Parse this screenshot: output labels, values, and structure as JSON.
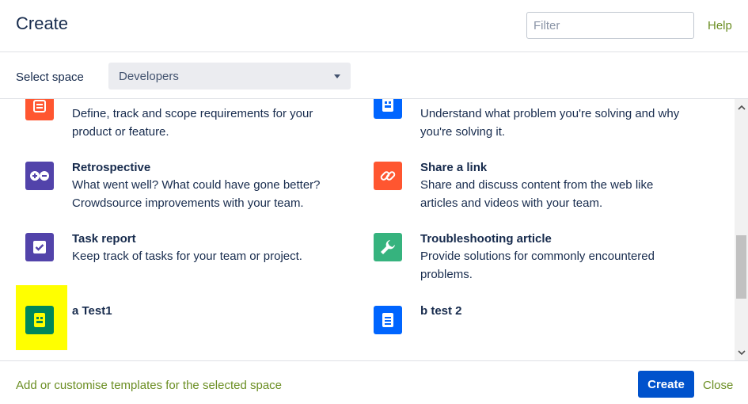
{
  "dialog": {
    "title": "Create",
    "filter_placeholder": "Filter",
    "help_label": "Help"
  },
  "space": {
    "label": "Select space",
    "selected": "Developers"
  },
  "templates": [
    {
      "name": "",
      "description": "Define, track and scope requirements for your product or feature.",
      "icon": "requirements-icon",
      "color": "#ff5630"
    },
    {
      "name": "",
      "description": "Understand what problem you're solving and why you're solving it.",
      "icon": "document-icon",
      "color": "#0065ff"
    },
    {
      "name": "Retrospective",
      "description": "What went well? What could have gone better? Crowdsource improvements with your team.",
      "icon": "retrospective-icon",
      "color": "#5243aa"
    },
    {
      "name": "Share a link",
      "description": "Share and discuss content from the web like articles and videos with your team.",
      "icon": "link-icon",
      "color": "#ff5630"
    },
    {
      "name": "Task report",
      "description": "Keep track of tasks for your team or project.",
      "icon": "checkbox-icon",
      "color": "#5243aa"
    },
    {
      "name": "Troubleshooting article",
      "description": "Provide solutions for commonly encountered problems.",
      "icon": "wrench-icon",
      "color": "#36b37e"
    },
    {
      "name": "a Test1",
      "description": "",
      "icon": "template-icon",
      "color": "#00875a",
      "highlight": "#ffff00"
    },
    {
      "name": "b test 2",
      "description": "",
      "icon": "document-icon",
      "color": "#0065ff"
    }
  ],
  "footer": {
    "customise_link": "Add or customise templates for the selected space",
    "create_label": "Create",
    "close_label": "Close"
  }
}
